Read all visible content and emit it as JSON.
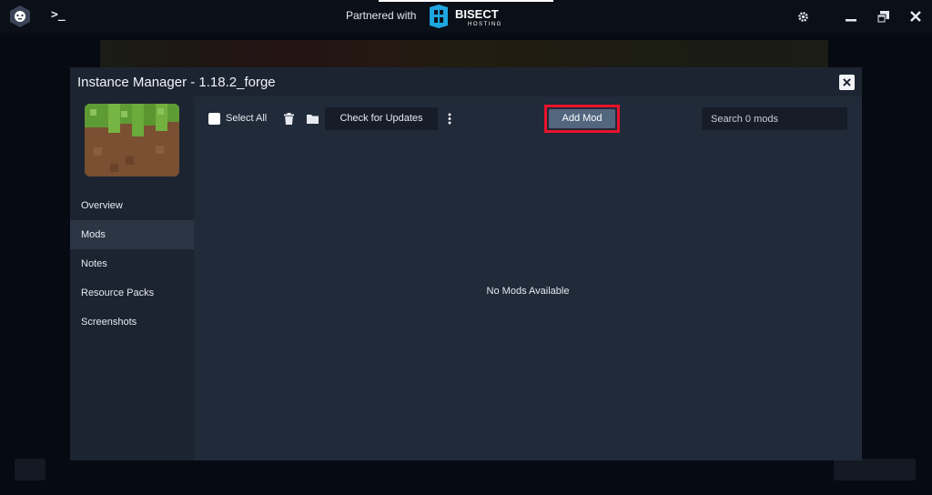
{
  "titlebar": {
    "partner_label": "Partnered with",
    "partner_brand": "BISECT",
    "partner_brand_sub": "HOSTING",
    "brand_color": "#00a8e8"
  },
  "modal": {
    "title": "Instance Manager - 1.18.2_forge",
    "sidebar": {
      "items": [
        {
          "label": "Overview"
        },
        {
          "label": "Mods",
          "active": true
        },
        {
          "label": "Notes"
        },
        {
          "label": "Resource Packs"
        },
        {
          "label": "Screenshots"
        }
      ]
    },
    "toolbar": {
      "select_all_label": "Select All",
      "check_updates_label": "Check for Updates",
      "add_mod_label": "Add Mod",
      "search_placeholder": "Search 0 mods",
      "highlight_color": "#e8132b"
    },
    "empty_message": "No Mods Available"
  }
}
